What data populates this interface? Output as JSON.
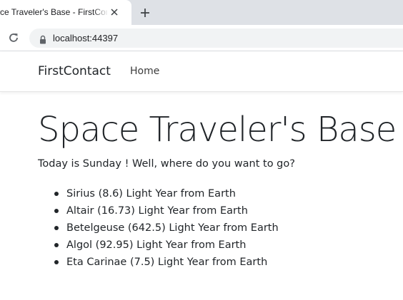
{
  "browser": {
    "tab_title": "ce Traveler's Base - FirstConta",
    "url": "localhost:44397"
  },
  "navbar": {
    "brand": "FirstContact",
    "links": [
      {
        "label": "Home"
      }
    ]
  },
  "main": {
    "title": "Space Traveler's Base",
    "greeting": "Today is Sunday ! Well, where do you want to go?",
    "destinations": [
      {
        "label": "Sirius (8.6) Light Year from Earth"
      },
      {
        "label": "Altair (16.73) Light Year from Earth"
      },
      {
        "label": "Betelgeuse (642.5) Light Year from Earth"
      },
      {
        "label": "Algol (92.95) Light Year from Earth"
      },
      {
        "label": "Eta Carinae (7.5) Light Year from Earth"
      }
    ]
  }
}
